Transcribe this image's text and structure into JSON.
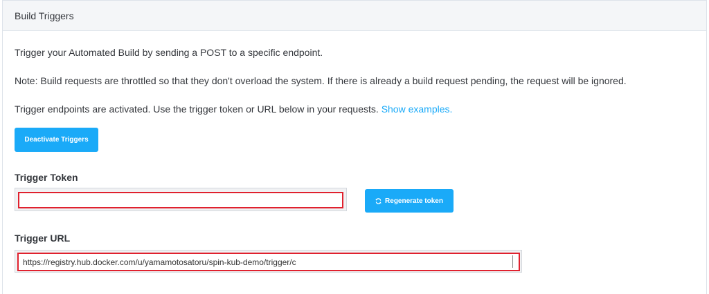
{
  "panel": {
    "title": "Build Triggers"
  },
  "intro": {
    "text": "Trigger your Automated Build by sending a POST to a specific endpoint."
  },
  "note": {
    "text": "Note: Build requests are throttled so that they don't overload the system. If there is already a build request pending, the request will be ignored."
  },
  "status": {
    "text": "Trigger endpoints are activated. Use the trigger token or URL below in your requests.",
    "link": "Show examples."
  },
  "deactivate_button": {
    "label": "Deactivate Triggers"
  },
  "trigger_token": {
    "label": "Trigger Token",
    "value": ""
  },
  "regenerate_button": {
    "label": "Regenerate token",
    "icon": "refresh-icon"
  },
  "trigger_url": {
    "label": "Trigger URL",
    "value": "https://registry.hub.docker.com/u/yamamotosatoru/spin-kub-demo/trigger/c"
  },
  "colors": {
    "accent": "#1aaaf8",
    "highlight": "#e0212e",
    "header_bg": "#f4f6f8"
  }
}
